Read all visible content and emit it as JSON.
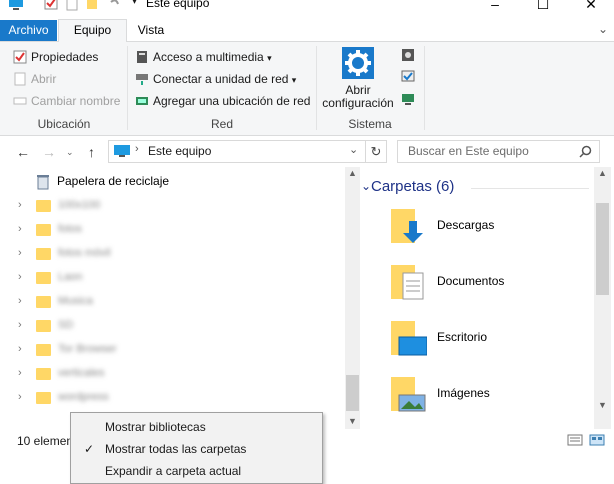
{
  "window": {
    "title": "Este equipo"
  },
  "ribbon": {
    "tabs": [
      "Archivo",
      "Equipo",
      "Vista"
    ],
    "ubicacion": {
      "label": "Ubicación",
      "items": [
        "Propiedades",
        "Abrir",
        "Cambiar nombre"
      ]
    },
    "red": {
      "label": "Red",
      "items": [
        "Acceso a multimedia",
        "Conectar a unidad de red",
        "Agregar una ubicación de red"
      ]
    },
    "sistema": {
      "label": "Sistema",
      "open_settings_line1": "Abrir",
      "open_settings_line2": "configuración"
    }
  },
  "address": {
    "path": "Este equipo",
    "search_placeholder": "Buscar en Este equipo"
  },
  "navpane": {
    "recycle_bin": "Papelera de reciclaje",
    "folders": [
      "100x100",
      "fotos",
      "fotos móvil",
      "Laon",
      "Musica",
      "SD",
      "Tor Browser",
      "verticales",
      "wordpress"
    ]
  },
  "content": {
    "group_header": "Carpetas (6)",
    "items": [
      "Descargas",
      "Documentos",
      "Escritorio",
      "Imágenes"
    ]
  },
  "status": {
    "text": "10 elemen"
  },
  "context_menu": {
    "items": [
      {
        "label": "Mostrar bibliotecas",
        "checked": false
      },
      {
        "label": "Mostrar todas las carpetas",
        "checked": true
      },
      {
        "label": "Expandir a carpeta actual",
        "checked": false
      }
    ]
  },
  "colors": {
    "accent": "#1979ca",
    "folder": "#ffd766",
    "group_header": "#1e3287"
  }
}
